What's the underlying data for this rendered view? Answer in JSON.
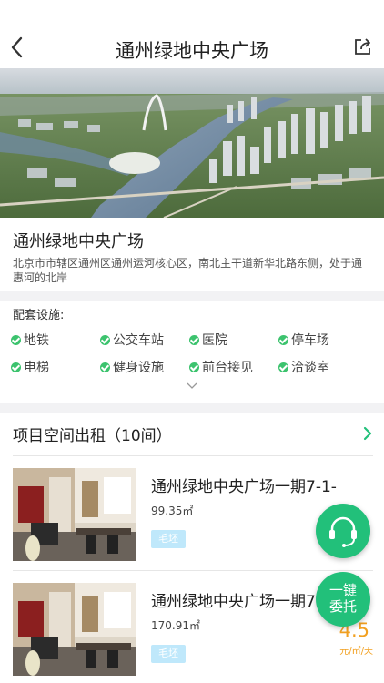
{
  "nav": {
    "title": "通州绿地中央广场"
  },
  "project": {
    "name": "通州绿地中央广场",
    "address": "北京市市辖区通州区通州运河核心区，南北主干道新华北路东侧，处于通惠河的北岸"
  },
  "facilities": {
    "label": "配套设施:",
    "items": [
      "地铁",
      "公交车站",
      "医院",
      "停车场",
      "电梯",
      "健身设施",
      "前台接见",
      "洽谈室"
    ]
  },
  "section": {
    "title": "项目空间出租（10间）"
  },
  "listings": [
    {
      "title": "通州绿地中央广场一期7-1-",
      "area": "99.35㎡",
      "tag": "毛坯",
      "price": "",
      "unit": ""
    },
    {
      "title": "通州绿地中央广场一期7",
      "area": "170.91㎡",
      "tag": "毛坯",
      "price": "4.5",
      "unit": "元/㎡/天"
    }
  ],
  "fab": {
    "entrust": "一键委托"
  },
  "colors": {
    "accent": "#22c07a",
    "price": "#f2a020",
    "check": "#3cc36e"
  }
}
